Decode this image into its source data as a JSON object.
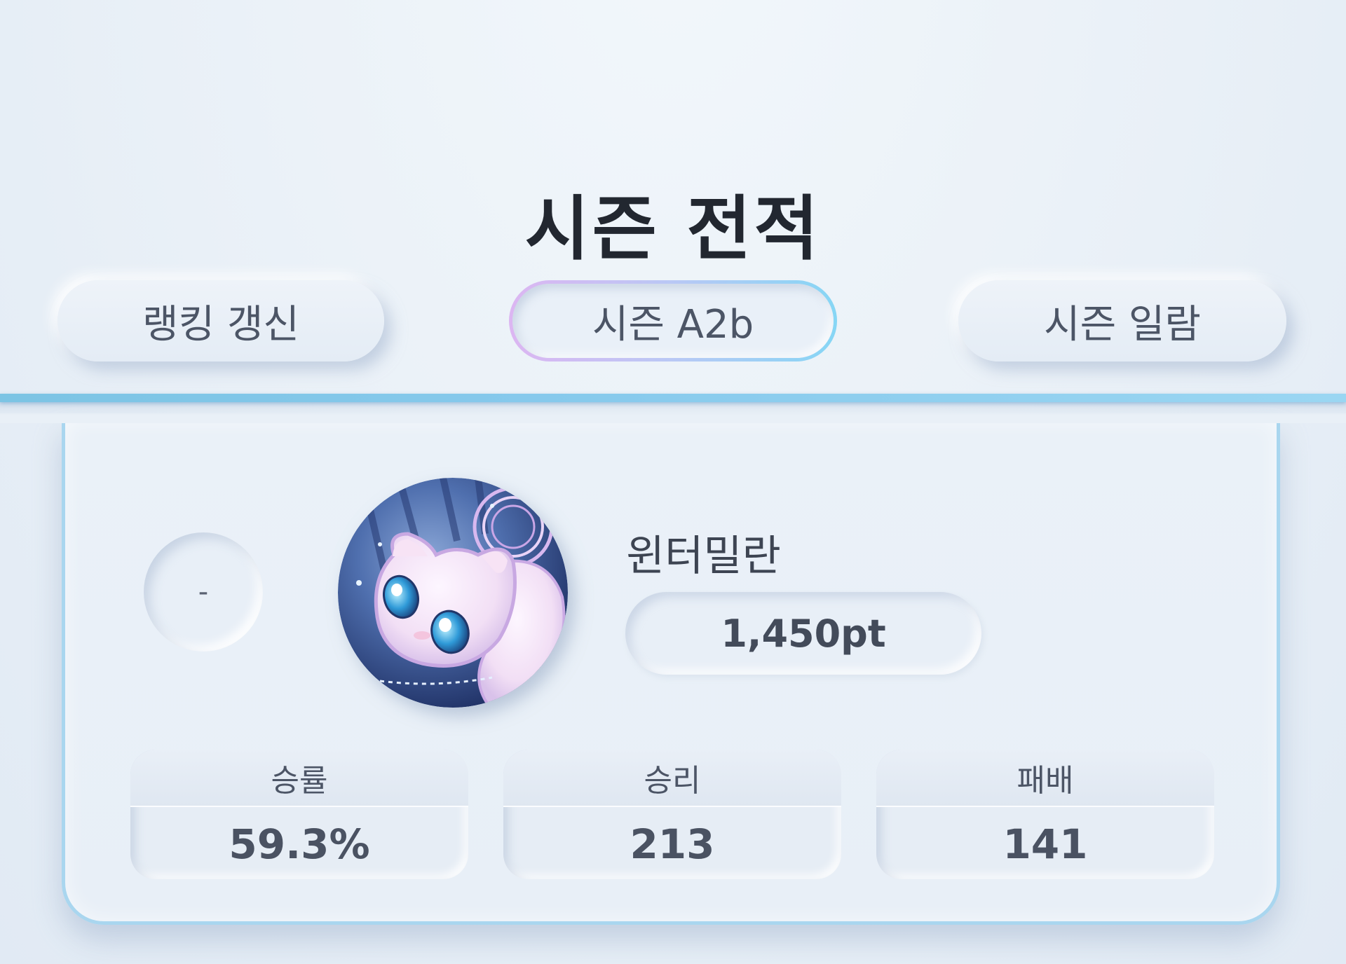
{
  "page": {
    "title": "시즌 전적"
  },
  "tabs": {
    "left_label": "랭킹 갱신",
    "center_label": "시즌 A2b",
    "right_label": "시즌 일람"
  },
  "profile": {
    "rank": "-",
    "avatar_icon": "mew-avatar",
    "name": "윈터밀란",
    "points": "1,450pt"
  },
  "stats": [
    {
      "label": "승률",
      "value": "59.3%"
    },
    {
      "label": "승리",
      "value": "213"
    },
    {
      "label": "패배",
      "value": "141"
    }
  ],
  "colors": {
    "divider": "#86c9ec",
    "card_border": "#a9d6ef",
    "active_tab_gradient_start": "#dcb6f2",
    "active_tab_gradient_end": "#86d6f5",
    "title_text": "#222730"
  }
}
